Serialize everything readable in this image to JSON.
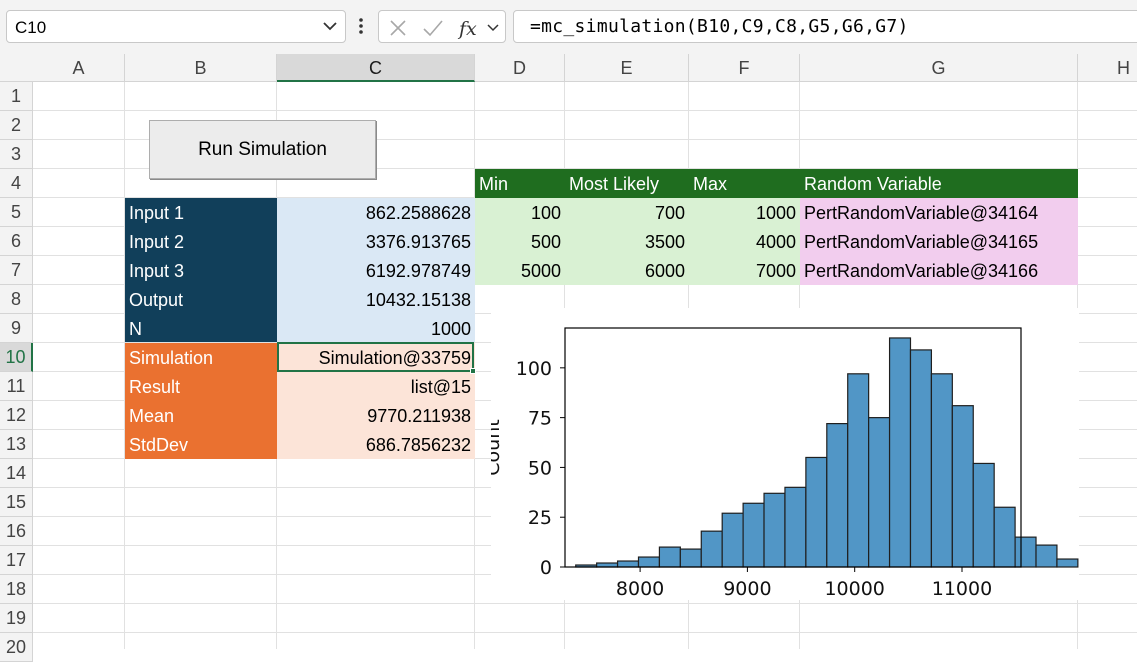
{
  "formula_bar": {
    "name_box": "C10",
    "formula": "=mc_simulation(B10,C9,C8,G5,G6,G7)",
    "icons": [
      "chevron-down-icon",
      "more-options-icon",
      "cancel-icon",
      "enter-icon",
      "insert-function-icon"
    ]
  },
  "columns": [
    "A",
    "B",
    "C",
    "D",
    "E",
    "F",
    "G",
    "H"
  ],
  "selected_column": "C",
  "rows": [
    "1",
    "2",
    "3",
    "4",
    "5",
    "6",
    "7",
    "8",
    "9",
    "10",
    "11",
    "12",
    "13",
    "14",
    "15",
    "16",
    "17",
    "18",
    "19",
    "20"
  ],
  "selected_row": "10",
  "button": {
    "label": "Run Simulation"
  },
  "inputs_table": {
    "labels": [
      "Input 1",
      "Input 2",
      "Input 3",
      "Output",
      "N"
    ],
    "values": [
      "862.2588628",
      "3376.913765",
      "6192.978749",
      "10432.15138",
      "1000"
    ]
  },
  "sim_table": {
    "labels": [
      "Simulation",
      "Result",
      "Mean",
      "StdDev"
    ],
    "values": [
      "Simulation@33759",
      "list@15",
      "9770.211938",
      "686.7856232"
    ]
  },
  "pert_table": {
    "headers": [
      "Min",
      "Most Likely",
      "Max",
      "Random Variable"
    ],
    "rows": [
      [
        "100",
        "700",
        "1000",
        "PertRandomVariable@34164"
      ],
      [
        "500",
        "3500",
        "4000",
        "PertRandomVariable@34165"
      ],
      [
        "5000",
        "6000",
        "7000",
        "PertRandomVariable@34166"
      ]
    ]
  },
  "colors": {
    "navy": "#113f5a",
    "light_blue": "#dae8f5",
    "orange": "#ea7130",
    "peach": "#fce4d8",
    "dark_green": "#1f6d1f",
    "light_green": "#d9f1d3",
    "pink": "#f2cdee",
    "bar_fill": "#5196c6",
    "selection": "#217346"
  },
  "chart_data": {
    "type": "bar",
    "title": "",
    "xlabel": "",
    "ylabel": "Count",
    "x_ticks": [
      "8000",
      "9000",
      "10000",
      "11000"
    ],
    "y_ticks": [
      "0",
      "25",
      "50",
      "75",
      "100"
    ],
    "xlim": [
      7300,
      11550
    ],
    "ylim": [
      0,
      120
    ],
    "bin_width": 195,
    "bin_starts": [
      7400,
      7595,
      7790,
      7985,
      8180,
      8375,
      8570,
      8765,
      8960,
      9155,
      9350,
      9545,
      9740,
      9935,
      10130,
      10325,
      10520,
      10715,
      10910,
      11105,
      11300
    ],
    "values": [
      1,
      2,
      3,
      5,
      10,
      9,
      18,
      27,
      32,
      37,
      40,
      55,
      72,
      97,
      75,
      115,
      109,
      97,
      81,
      52,
      30,
      15,
      11,
      4
    ]
  }
}
